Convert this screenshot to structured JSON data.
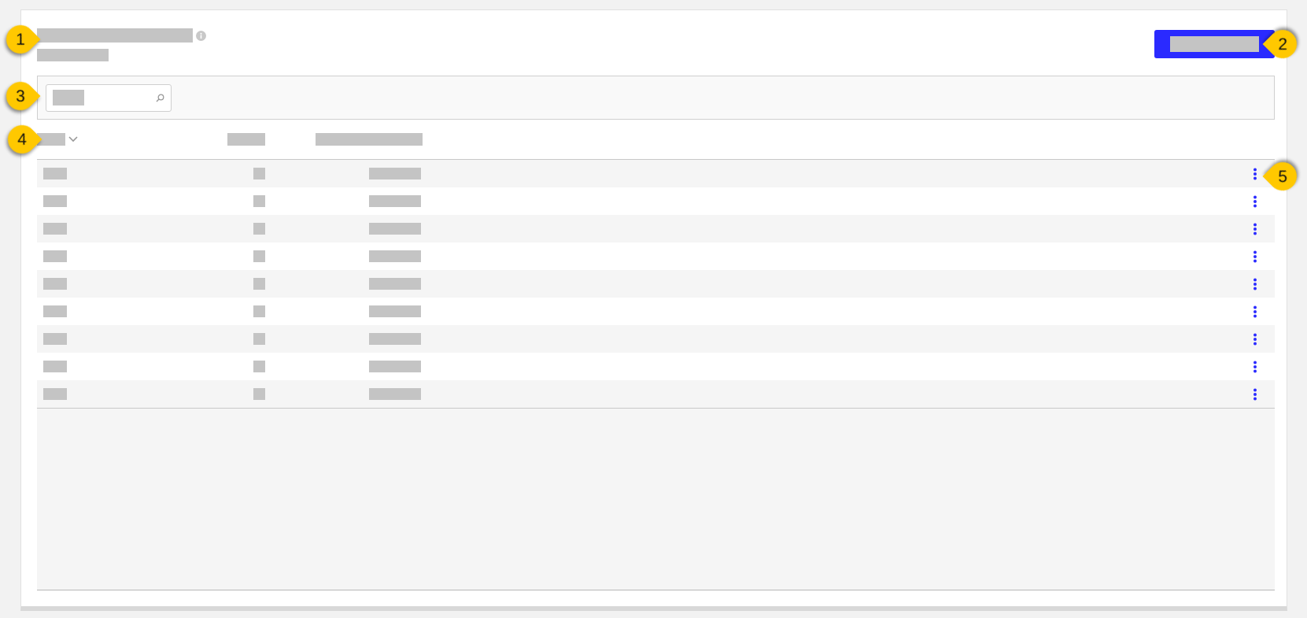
{
  "primary_button": {
    "kind": "redacted"
  },
  "search": {
    "kind": "redacted"
  },
  "table": {
    "columns": [
      {
        "sort_indicator": true
      },
      {
        "sort_indicator": false
      },
      {
        "sort_indicator": false
      }
    ],
    "rows": [
      {
        "kind": "redacted"
      },
      {
        "kind": "redacted"
      },
      {
        "kind": "redacted"
      },
      {
        "kind": "redacted"
      },
      {
        "kind": "redacted"
      },
      {
        "kind": "redacted"
      },
      {
        "kind": "redacted"
      },
      {
        "kind": "redacted"
      },
      {
        "kind": "redacted"
      }
    ]
  },
  "callouts": [
    {
      "label": "1"
    },
    {
      "label": "2"
    },
    {
      "label": "3"
    },
    {
      "label": "4"
    },
    {
      "label": "5"
    }
  ]
}
